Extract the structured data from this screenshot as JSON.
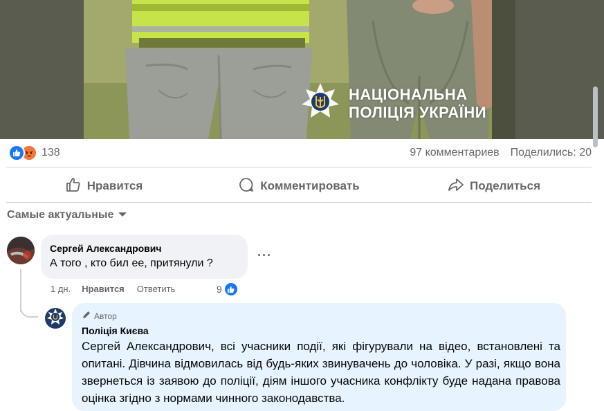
{
  "post": {
    "watermark": {
      "line1": "НАЦІОНАЛЬНА",
      "line2": "ПОЛІЦІЯ УКРАЇНИ"
    },
    "reactions_count": "138",
    "comments_count": "97 комментариев",
    "shares_count": "Поделились: 20"
  },
  "actions": {
    "like": "Нравится",
    "comment": "Комментировать",
    "share": "Поделиться"
  },
  "comments_sort": {
    "label": "Самые актуальные"
  },
  "comment": {
    "author": "Сергей Александрович",
    "text": "А того , кто бил ее, притянули ?",
    "time": "1 дн.",
    "like_action": "Нравится",
    "reply_action": "Ответить",
    "like_count": "9",
    "more": "···"
  },
  "reply": {
    "badge": "Автор",
    "author": "Поліція Києва",
    "text": "Сергей Александрович, всі учасники події, які фігурували на відео, встановлені та опитані. Дівчина відмовилась від будь-яких звинувачень до чоловіка. У разі, якщо вона звернеться із заявою до поліції, діям іншого учасника конфлікту буде надана правова оцінка згідно з нормами чинного законодавства."
  },
  "colors": {
    "brand_blue": "#1877f2",
    "angry": "#f3783b",
    "muted_text": "#65676b",
    "reply_bubble": "#e7f3ff",
    "comment_bubble": "#f0f2f5"
  },
  "icons": [
    "like-reaction-icon",
    "angry-reaction-icon",
    "thumbs-up-icon",
    "comment-icon",
    "share-icon",
    "chevron-down-icon",
    "pencil-icon",
    "police-logo-icon"
  ]
}
